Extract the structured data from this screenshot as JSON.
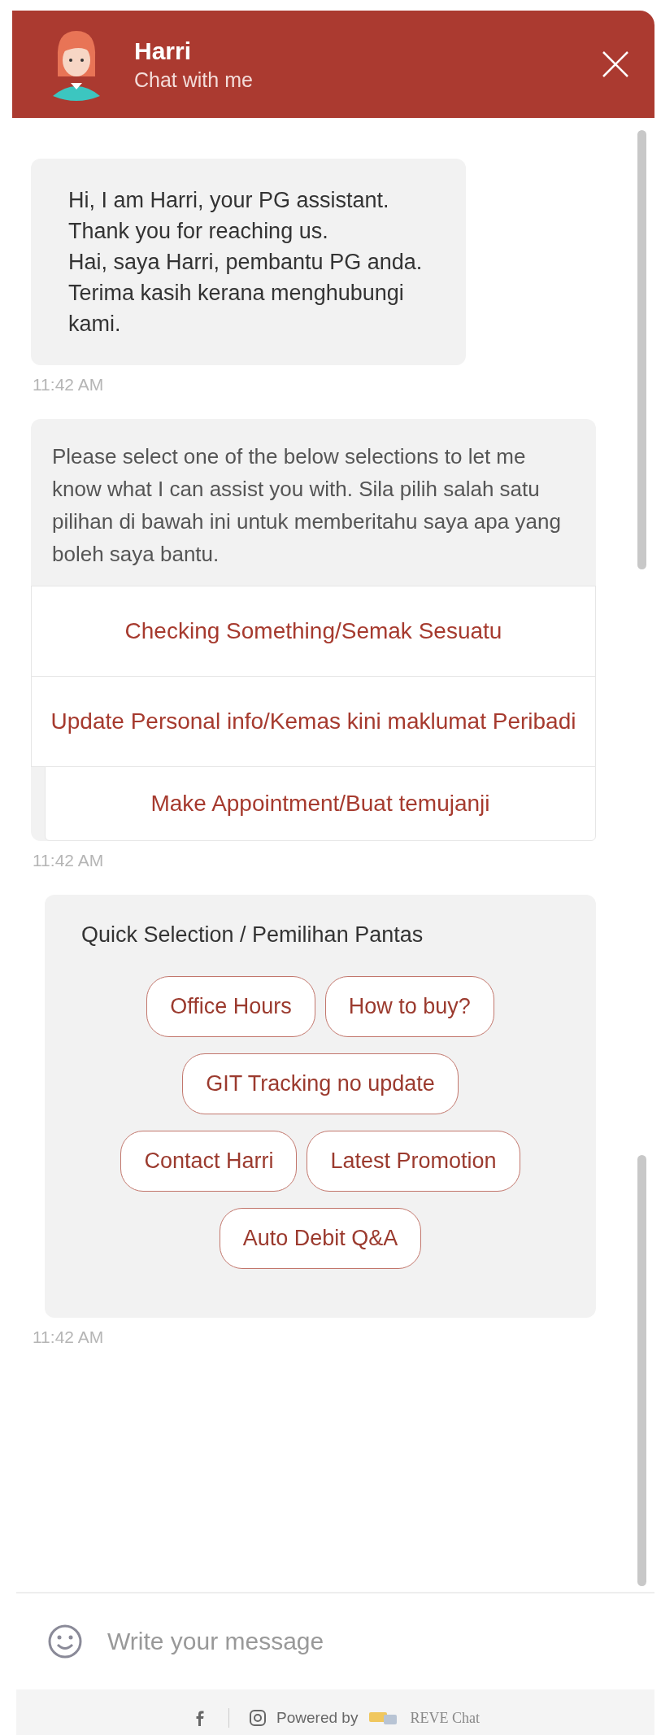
{
  "header": {
    "name": "Harri",
    "subtitle": "Chat with me"
  },
  "messages": [
    {
      "kind": "text",
      "paragraphs": [
        "Hi, I am Harri, your PG assistant. Thank you for reaching us.",
        "Hai, saya Harri, pembantu PG anda. Terima kasih kerana menghubungi kami."
      ],
      "time": "11:42 AM"
    },
    {
      "kind": "options",
      "text": "Please select one of the below selections to let me know what I can assist you with. Sila pilih salah satu pilihan di bawah ini untuk memberitahu saya apa yang boleh saya bantu.",
      "options": [
        "Checking Something/Semak Sesuatu",
        "Update Personal info/Kemas kini maklumat Peribadi",
        "Make Appointment/Buat temujanji"
      ],
      "time": "11:42 AM"
    },
    {
      "kind": "quick",
      "title": "Quick Selection / Pemilihan Pantas",
      "chips": [
        "Office Hours",
        "How to buy?",
        "GIT Tracking no update",
        "Contact Harri",
        "Latest Promotion",
        "Auto Debit Q&A"
      ],
      "time": "11:42 AM"
    }
  ],
  "composer": {
    "placeholder": "Write your message"
  },
  "footer": {
    "powered_by": "Powered by",
    "brand": "REVE Chat"
  }
}
